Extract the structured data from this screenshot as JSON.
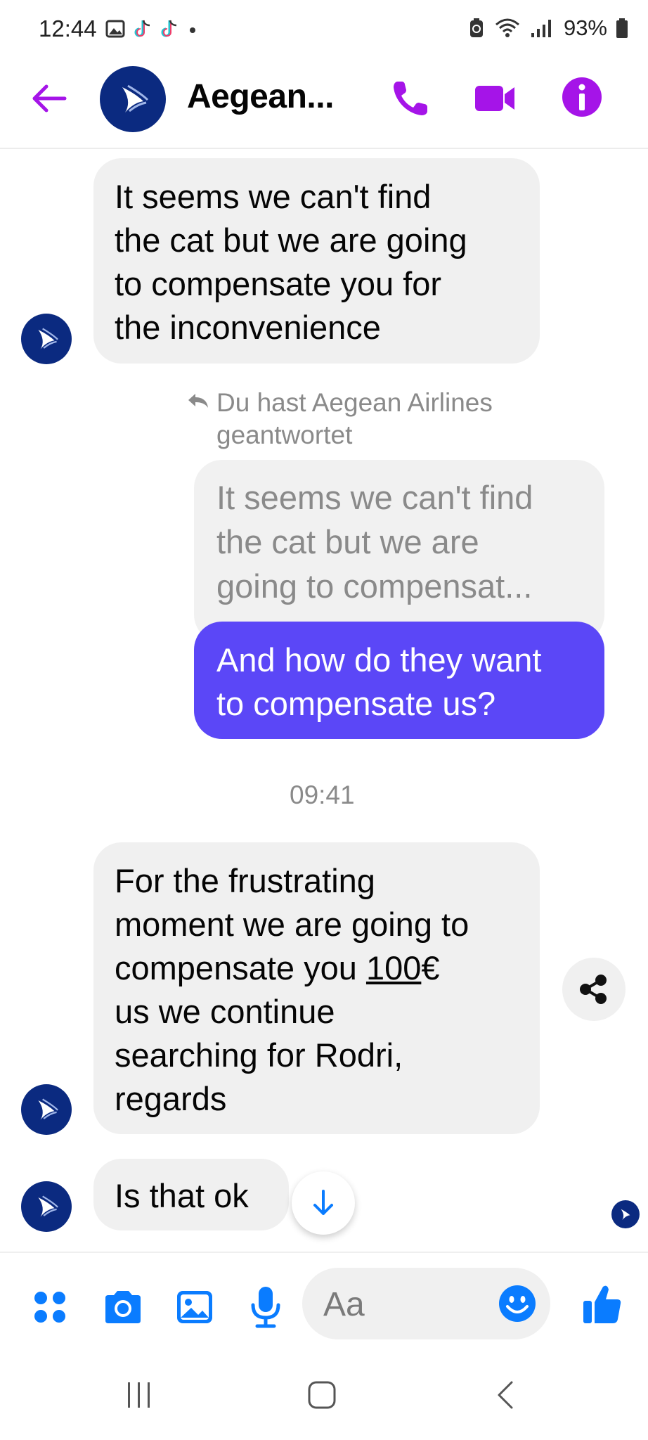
{
  "status_bar": {
    "time": "12:44",
    "battery": "93%",
    "icons_left": [
      "gallery-icon",
      "tiktok-icon",
      "tiktok-icon",
      "dot-icon"
    ],
    "icons_right": [
      "battery-saver-icon",
      "wifi-icon",
      "signal-icon",
      "battery-icon"
    ]
  },
  "header": {
    "title": "Aegean...",
    "accent_color": "#a514e8",
    "icons": [
      "back-arrow-icon",
      "phone-icon",
      "video-camera-icon",
      "info-icon"
    ]
  },
  "messages": {
    "m1": {
      "sender": "Aegean Airlines",
      "lines": [
        "It seems we can't find",
        "the cat but we are going",
        "to compensate you for",
        "the inconvenience"
      ]
    },
    "reply_note": [
      "Du hast Aegean Airlines",
      "geantwortet"
    ],
    "quoted": [
      "It seems we can't find",
      "the cat but we are",
      "going to compensat..."
    ],
    "m2": {
      "lines": [
        "And how do they want",
        "to compensate us?"
      ],
      "color": "#5b47f7"
    },
    "timestamp": "09:41",
    "m3": {
      "line1": "For the frustrating",
      "line2": "moment we are going to",
      "line3_before": "compensate you ",
      "line3_underlined": "100",
      "line3_after": "€",
      "line4": "us we continue",
      "line5": "searching for Rodri,",
      "line6": "regards"
    },
    "m4": {
      "text": "Is that ok"
    }
  },
  "composer": {
    "placeholder": "Aa",
    "icons": [
      "apps-grid-icon",
      "camera-icon",
      "gallery-icon",
      "microphone-icon",
      "emoji-icon",
      "thumbs-up-icon"
    ],
    "icon_color": "#0a7cff"
  },
  "nav_bar": {
    "icons": [
      "recents-icon",
      "home-icon",
      "back-icon"
    ]
  }
}
